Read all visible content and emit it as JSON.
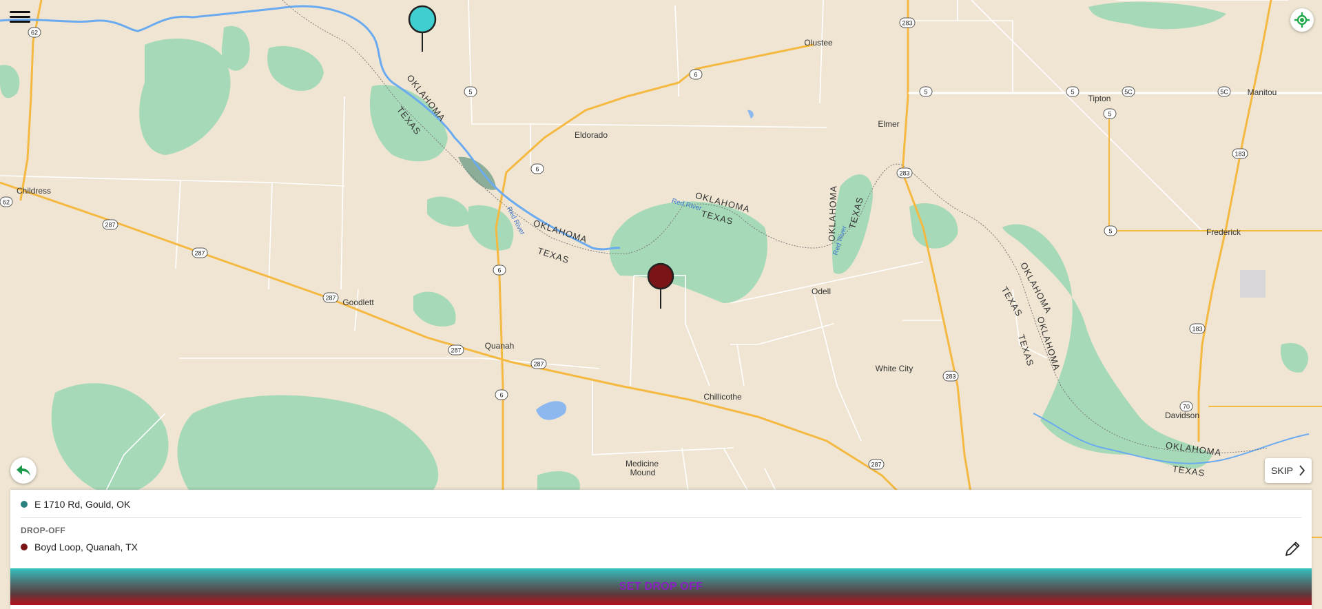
{
  "map": {
    "places": [
      {
        "name": "Olustee"
      },
      {
        "name": "Elmer"
      },
      {
        "name": "Tipton"
      },
      {
        "name": "Manitou"
      },
      {
        "name": "Eldorado"
      },
      {
        "name": "Childress"
      },
      {
        "name": "Goodlett"
      },
      {
        "name": "Quanah"
      },
      {
        "name": "Odell"
      },
      {
        "name": "White City"
      },
      {
        "name": "Chillicothe"
      },
      {
        "name": "Frederick"
      },
      {
        "name": "Davidson"
      },
      {
        "name": "Medicine"
      },
      {
        "name": "Mound"
      }
    ],
    "state_labels": [
      {
        "text": "OKLAHOMA"
      },
      {
        "text": "TEXAS"
      },
      {
        "text": "OKLAHOMA"
      },
      {
        "text": "TEXAS"
      },
      {
        "text": "OKLAHOMA"
      },
      {
        "text": "TEXAS"
      },
      {
        "text": "OKLAHOMA"
      },
      {
        "text": "TEXAS"
      },
      {
        "text": "OKLAHOMA"
      },
      {
        "text": "TEXAS"
      },
      {
        "text": "OKLAHOMA"
      },
      {
        "text": "TEXAS"
      },
      {
        "text": "OKLAHOMA"
      },
      {
        "text": "TEXAS"
      }
    ],
    "river_labels": [
      {
        "text": "Red River"
      },
      {
        "text": "Red River"
      },
      {
        "text": "Red River"
      }
    ],
    "shields": [
      "62",
      "5",
      "6",
      "283",
      "5",
      "5",
      "5C",
      "5C",
      "5",
      "6",
      "183",
      "283",
      "62",
      "287",
      "287",
      "6",
      "287",
      "287",
      "287",
      "6",
      "283",
      "183",
      "70",
      "287",
      "5"
    ],
    "colors": {
      "land": "#efe5d2",
      "park": "#a6d9b7",
      "water": "#6aaaf0",
      "highway": "#f5b942",
      "road": "#ffffff"
    }
  },
  "pins": {
    "pickup_color": "#3fcfd0",
    "dropoff_color": "#7a1416"
  },
  "controls": {
    "menu_icon": "hamburger-menu-icon",
    "locate_icon": "my-location-icon",
    "back_icon": "back-arrow-icon",
    "skip_label": "SKIP"
  },
  "panel": {
    "pickup_address": "E 1710 Rd, Gould, OK",
    "pickup_dot_color": "#2a7f7f",
    "dropoff_label": "DROP-OFF",
    "dropoff_address": "Boyd Loop, Quanah, TX",
    "dropoff_dot_color": "#7a1416",
    "edit_icon": "pencil-icon",
    "cta_label": "SET DROP OFF"
  }
}
